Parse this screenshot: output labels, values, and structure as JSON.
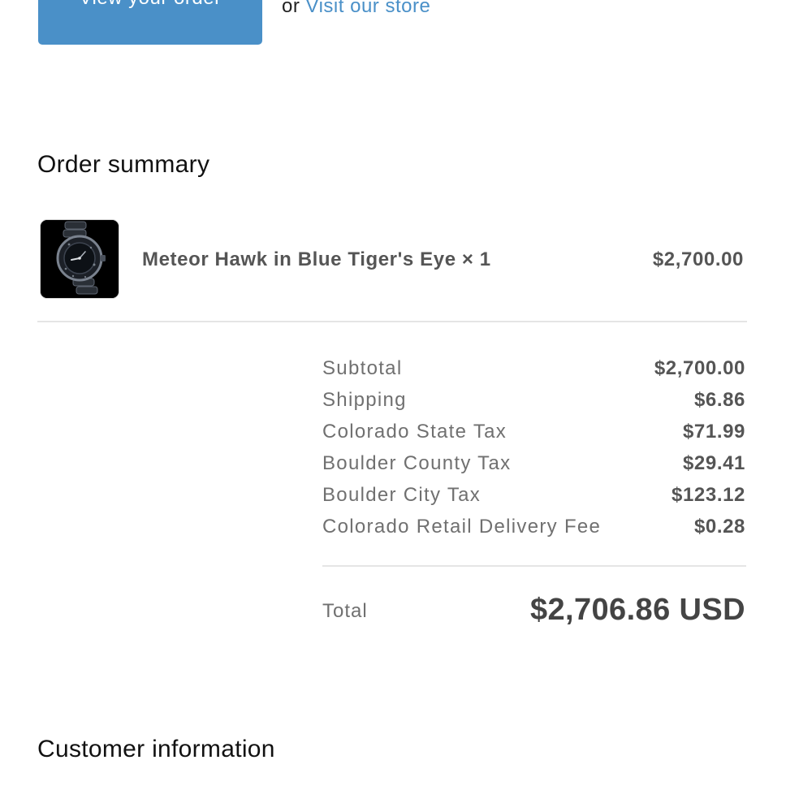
{
  "actions": {
    "view_order_label": "View your order",
    "or_text": "or",
    "visit_store_label": "Visit our store"
  },
  "order_summary": {
    "title": "Order summary",
    "item": {
      "image_icon": "watch-product-thumbnail",
      "name": "Meteor Hawk in Blue Tiger's Eye × 1",
      "price": "$2,700.00"
    },
    "lines": [
      {
        "label": "Subtotal",
        "value": "$2,700.00"
      },
      {
        "label": "Shipping",
        "value": "$6.86"
      },
      {
        "label": "Colorado State Tax",
        "value": "$71.99"
      },
      {
        "label": "Boulder County Tax",
        "value": "$29.41"
      },
      {
        "label": "Boulder City Tax",
        "value": "$123.12"
      },
      {
        "label": "Colorado Retail Delivery Fee",
        "value": "$0.28"
      }
    ],
    "total_label": "Total",
    "total_value": "$2,706.86 USD"
  },
  "customer_information": {
    "title": "Customer information"
  },
  "colors": {
    "accent": "#4a90c8",
    "muted_text": "#707070",
    "value_text": "#555555"
  }
}
